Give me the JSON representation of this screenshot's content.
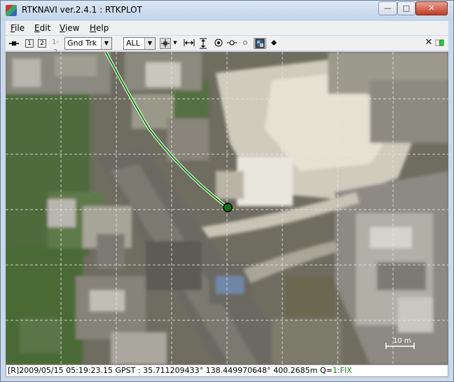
{
  "window": {
    "title": "RTKNAVI ver.2.4.1 : RTKPLOT",
    "minimize_glyph": "—",
    "restore_glyph": "□",
    "close_glyph": "✕"
  },
  "menu": {
    "items": [
      {
        "underline": "F",
        "rest": "ile"
      },
      {
        "underline": "E",
        "rest": "dit"
      },
      {
        "underline": "V",
        "rest": "iew"
      },
      {
        "underline": "H",
        "rest": "elp"
      }
    ]
  },
  "toolbar": {
    "rover1": "1",
    "rover2": "2",
    "rover12": "1-2",
    "plot_type": "Gnd Trk",
    "quality_filter": "ALL",
    "close_glyph": "✕"
  },
  "map": {
    "scale_label": "10 m",
    "track_color": "#0a8a0a",
    "marker_color": "#0b7a0b"
  },
  "status": {
    "prefix": "[R]",
    "datetime": "2009/05/15 05:19:23.15 GPST",
    "separator": " : ",
    "lat": "35.711209433°",
    "lon": "138.449970648°",
    "height": "400.2685m",
    "q_label": "Q=",
    "q_value": "1:FIX"
  }
}
